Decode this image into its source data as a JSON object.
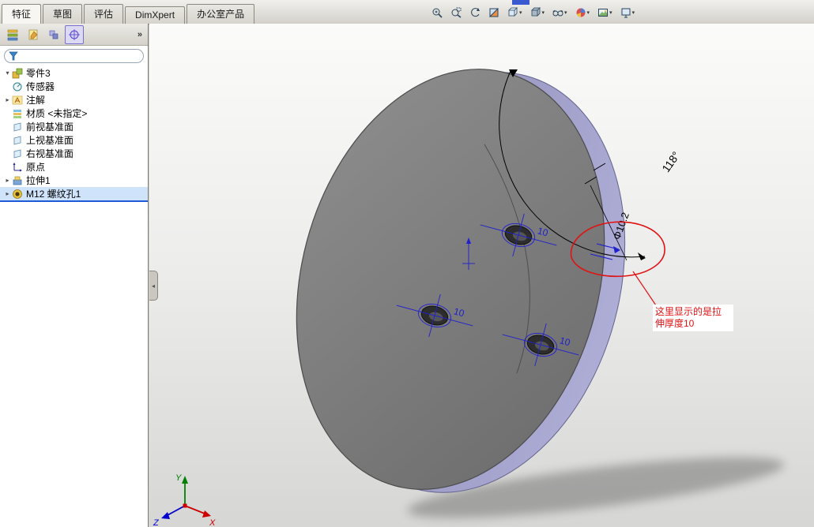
{
  "glyphs": {
    "dropdown": "▾",
    "chevron": "»",
    "expander": "▸",
    "expander_open": "▾",
    "collapse": "◂"
  },
  "tabs": {
    "items": [
      {
        "label": "特征",
        "active": true
      },
      {
        "label": "草图",
        "active": false
      },
      {
        "label": "评估",
        "active": false
      },
      {
        "label": "DimXpert",
        "active": false
      },
      {
        "label": "办公室产品",
        "active": false
      }
    ]
  },
  "heads_up": {
    "icons": [
      {
        "name": "zoom-to-fit-icon",
        "dropdown": false
      },
      {
        "name": "zoom-to-area-icon",
        "dropdown": false
      },
      {
        "name": "previous-view-icon",
        "dropdown": false
      },
      {
        "name": "section-view-icon",
        "dropdown": false
      },
      {
        "name": "view-orientation-icon",
        "dropdown": true
      },
      {
        "name": "display-style-icon",
        "dropdown": true
      },
      {
        "name": "hide-show-items-icon",
        "dropdown": true
      },
      {
        "name": "edit-appearance-icon",
        "dropdown": true
      },
      {
        "name": "apply-scene-icon",
        "dropdown": true
      },
      {
        "name": "view-settings-icon",
        "dropdown": true
      }
    ]
  },
  "panel_tabs": {
    "icons": [
      {
        "name": "feature-manager-tab"
      },
      {
        "name": "property-manager-tab"
      },
      {
        "name": "configuration-manager-tab"
      },
      {
        "name": "dimxpert-manager-tab",
        "active": true
      }
    ]
  },
  "tree": {
    "root": {
      "label": "零件3"
    },
    "items": [
      {
        "label": "传感器"
      },
      {
        "label": "注解",
        "expand": true
      },
      {
        "label": "材质 <未指定>"
      },
      {
        "label": "前视基准面"
      },
      {
        "label": "上视基准面"
      },
      {
        "label": "右视基准面"
      },
      {
        "label": "原点"
      },
      {
        "label": "拉伸1",
        "expand": true
      },
      {
        "label": "M12 螺纹孔1",
        "expand": true,
        "selected": true
      }
    ]
  },
  "viewport": {
    "angle_dim": "118°",
    "diameter_dim": "Φ10.2",
    "hole_dims": [
      "10",
      "10",
      "10"
    ],
    "note": {
      "line1": "这里显示的是拉",
      "line2": "伸厚度10"
    },
    "triad": {
      "x": "X",
      "y": "Y",
      "z": "Z"
    }
  },
  "colors": {
    "selection_blue": "#1e5ad7",
    "dimension_blue": "#2020cf",
    "annotation_red": "#e01212",
    "disc_gray": "#7d7d7d",
    "rim_lavender": "#9d9dc8"
  }
}
